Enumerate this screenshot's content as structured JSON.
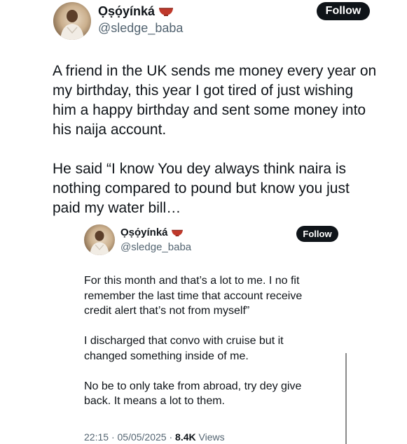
{
  "tweet": {
    "author": {
      "name": "Ọṣọ́yínká",
      "handle": "@sledge_baba",
      "avatar_icon": "profile-photo",
      "name_emoji_icon": "bowl-emoji-icon"
    },
    "follow_label": "Follow",
    "paragraph1": "A friend in the UK sends me money every year on\nmy birthday, this year I got tired of just wishing\nhim a happy birthday and sent some money into\nhis naija account.",
    "paragraph2": "He said “I know You dey always think naira is\nnothing compared to pound but know you just\npaid my water bill…"
  },
  "reply": {
    "author": {
      "name": "Ọṣọ́yínká",
      "handle": "@sledge_baba",
      "avatar_icon": "profile-photo",
      "name_emoji_icon": "bowl-emoji-icon"
    },
    "follow_label": "Follow",
    "paragraph1": "For this month and that’s a lot to me. I no fit\nremember the last time that account receive\ncredit alert that’s not from myself”",
    "paragraph2": "I discharged that convo with cruise but it\nchanged something inside of me.",
    "paragraph3": "No be to only take from abroad, try dey give\nback. It means a lot to them.",
    "meta": {
      "time": "22:15",
      "date": "05/05/2025",
      "views_count": "8.4K",
      "views_label": "Views"
    }
  },
  "colors": {
    "text": "#0f1419",
    "secondary": "#536471",
    "button": "#0f1419",
    "background": "#ffffff"
  }
}
